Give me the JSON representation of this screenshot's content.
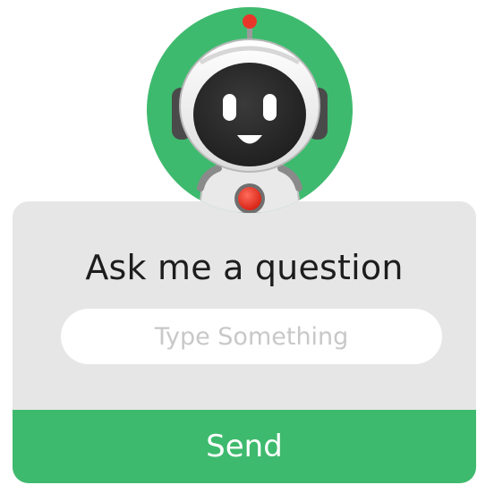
{
  "avatar": {
    "icon": "robot-avatar-icon",
    "circle_color": "#3eba6e"
  },
  "card": {
    "title": "Ask me a question"
  },
  "input": {
    "placeholder": "Type Something",
    "value": ""
  },
  "send": {
    "label": "Send",
    "color": "#3eba6e"
  }
}
